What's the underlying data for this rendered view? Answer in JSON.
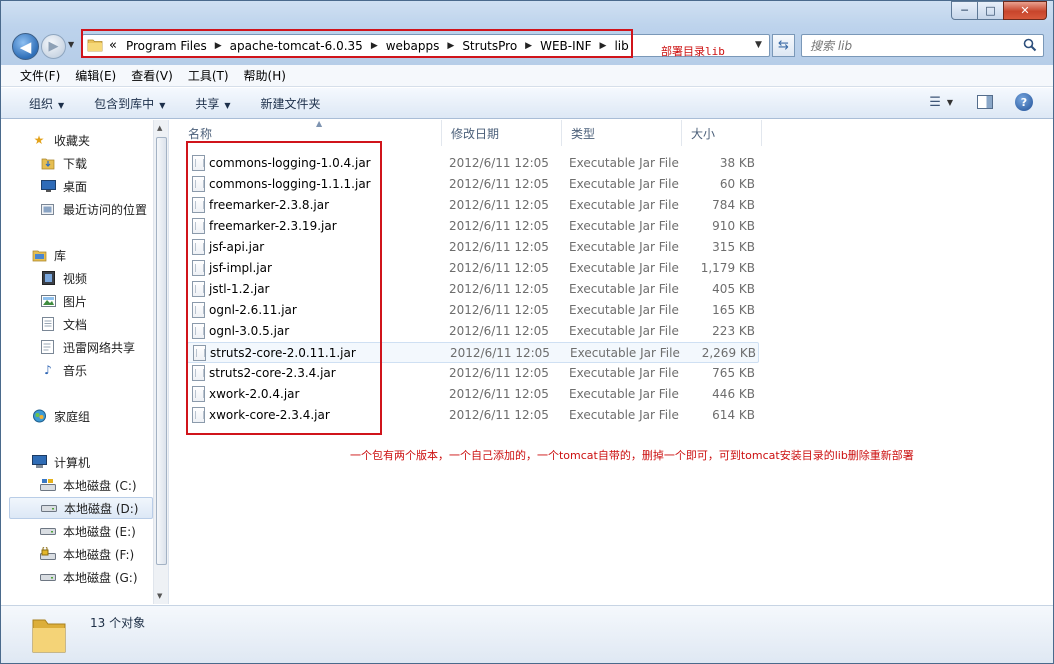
{
  "window": {
    "caption": {
      "minimize": "─",
      "maximize": "□",
      "close": "✕"
    }
  },
  "address": {
    "overflow": "«",
    "crumbs": [
      "Program Files",
      "apache-tomcat-6.0.35",
      "webapps",
      "StrutsPro",
      "WEB-INF",
      "lib"
    ],
    "separator": "▶",
    "annotation": "部署目录lib"
  },
  "search": {
    "placeholder": "搜索 lib"
  },
  "menu": [
    "文件(F)",
    "编辑(E)",
    "查看(V)",
    "工具(T)",
    "帮助(H)"
  ],
  "toolbar": {
    "organize": "组织",
    "include_library": "包含到库中",
    "share": "共享",
    "new_folder": "新建文件夹"
  },
  "nav": {
    "favorites": "收藏夹",
    "downloads": "下载",
    "desktop": "桌面",
    "recent": "最近访问的位置",
    "libraries": "库",
    "videos": "视频",
    "pictures": "图片",
    "documents": "文档",
    "xunlei": "迅雷网络共享",
    "music": "音乐",
    "homegroup": "家庭组",
    "computer": "计算机",
    "drive_c": "本地磁盘 (C:)",
    "drive_d": "本地磁盘 (D:)",
    "drive_e": "本地磁盘 (E:)",
    "drive_f": "本地磁盘 (F:)",
    "drive_g": "本地磁盘 (G:)"
  },
  "columns": {
    "name": "名称",
    "modified": "修改日期",
    "type": "类型",
    "size": "大小"
  },
  "files": [
    {
      "name": "commons-logging-1.0.4.jar",
      "modified": "2012/6/11 12:05",
      "type": "Executable Jar File",
      "size": "38 KB"
    },
    {
      "name": "commons-logging-1.1.1.jar",
      "modified": "2012/6/11 12:05",
      "type": "Executable Jar File",
      "size": "60 KB"
    },
    {
      "name": "freemarker-2.3.8.jar",
      "modified": "2012/6/11 12:05",
      "type": "Executable Jar File",
      "size": "784 KB"
    },
    {
      "name": "freemarker-2.3.19.jar",
      "modified": "2012/6/11 12:05",
      "type": "Executable Jar File",
      "size": "910 KB"
    },
    {
      "name": "jsf-api.jar",
      "modified": "2012/6/11 12:05",
      "type": "Executable Jar File",
      "size": "315 KB"
    },
    {
      "name": "jsf-impl.jar",
      "modified": "2012/6/11 12:05",
      "type": "Executable Jar File",
      "size": "1,179 KB"
    },
    {
      "name": "jstl-1.2.jar",
      "modified": "2012/6/11 12:05",
      "type": "Executable Jar File",
      "size": "405 KB"
    },
    {
      "name": "ognl-2.6.11.jar",
      "modified": "2012/6/11 12:05",
      "type": "Executable Jar File",
      "size": "165 KB"
    },
    {
      "name": "ognl-3.0.5.jar",
      "modified": "2012/6/11 12:05",
      "type": "Executable Jar File",
      "size": "223 KB"
    },
    {
      "name": "struts2-core-2.0.11.1.jar",
      "modified": "2012/6/11 12:05",
      "type": "Executable Jar File",
      "size": "2,269 KB"
    },
    {
      "name": "struts2-core-2.3.4.jar",
      "modified": "2012/6/11 12:05",
      "type": "Executable Jar File",
      "size": "765 KB"
    },
    {
      "name": "xwork-2.0.4.jar",
      "modified": "2012/6/11 12:05",
      "type": "Executable Jar File",
      "size": "446 KB"
    },
    {
      "name": "xwork-core-2.3.4.jar",
      "modified": "2012/6/11 12:05",
      "type": "Executable Jar File",
      "size": "614 KB"
    }
  ],
  "annotation_files": "一个包有两个版本，一个自己添加的，一个tomcat自带的，删掉一个即可，可到tomcat安装目录的lib删除重新部署",
  "status": {
    "count": "13 个对象"
  },
  "colors": {
    "annotation_red": "#d0141b",
    "accent_blue": "#2f6fb8"
  }
}
